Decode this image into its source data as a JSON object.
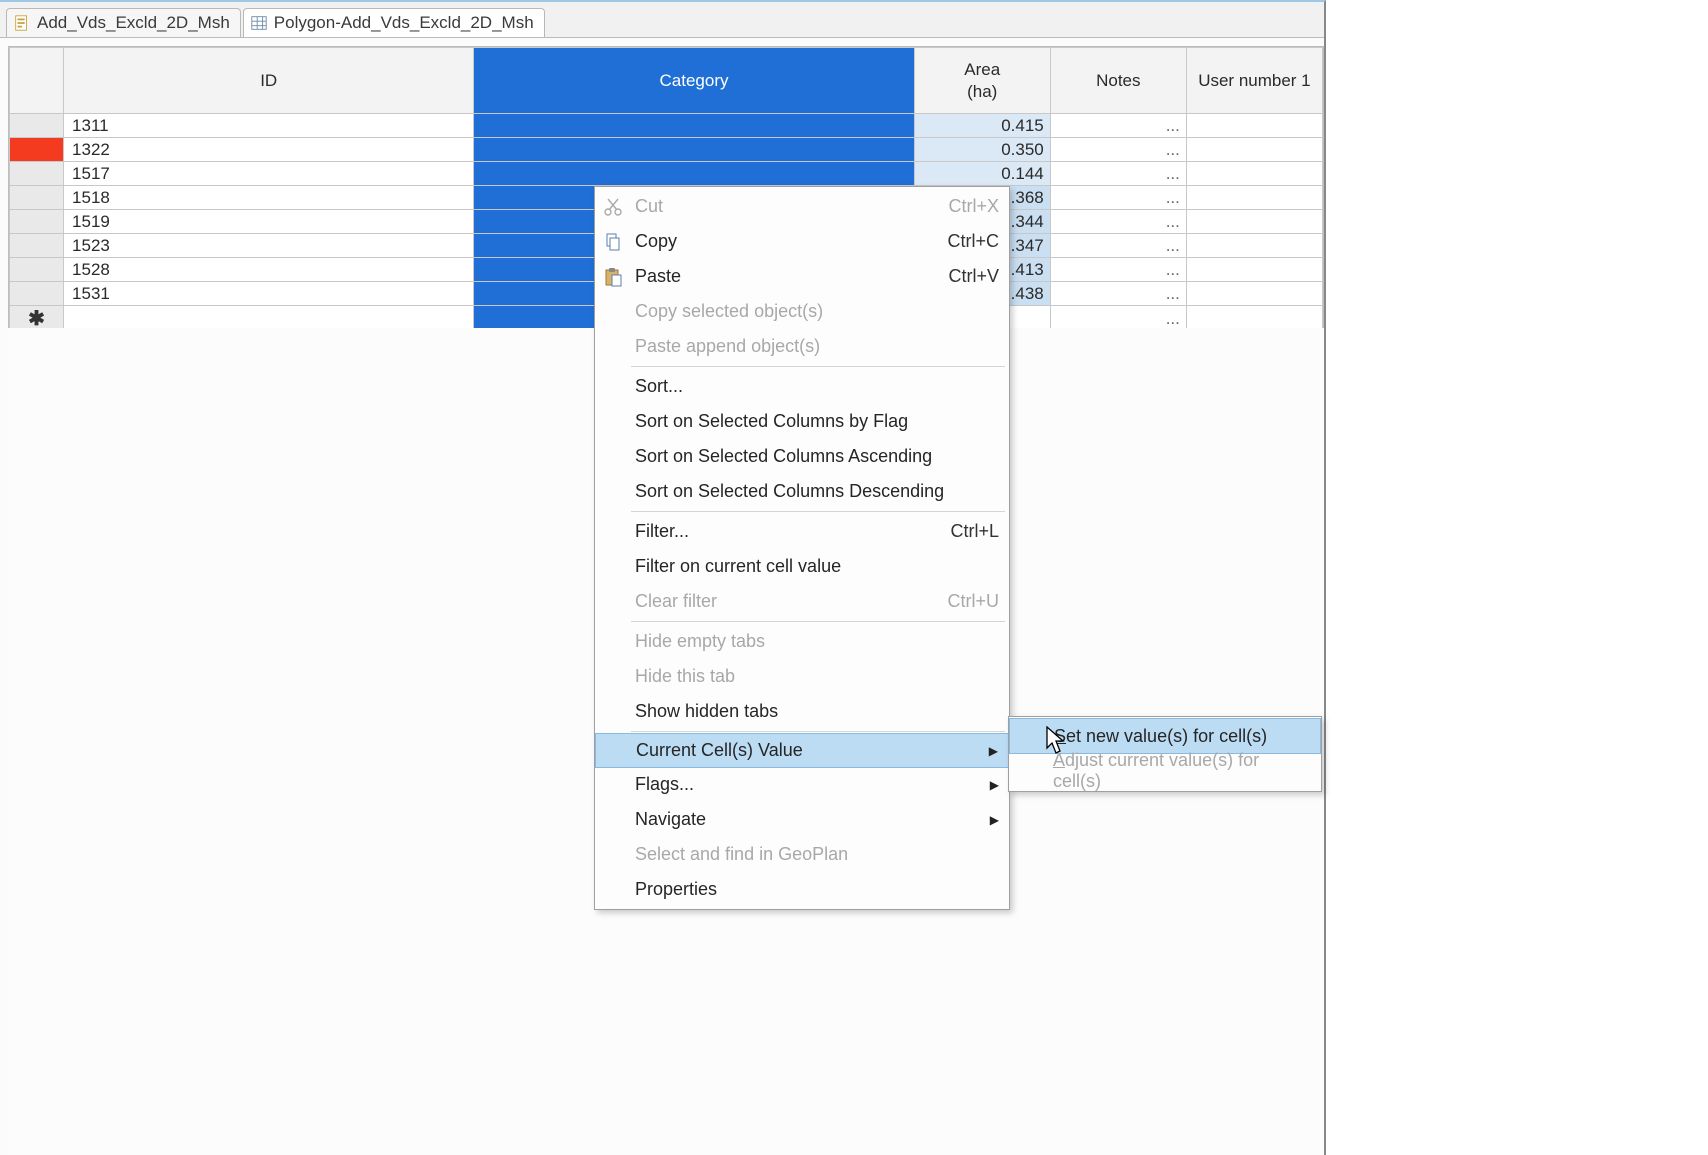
{
  "tabs": [
    {
      "label": "Add_Vds_Excld_2D_Msh",
      "icon": "doc"
    },
    {
      "label": "Polygon-Add_Vds_Excld_2D_Msh",
      "icon": "table"
    }
  ],
  "columns": {
    "id": "ID",
    "category": "Category",
    "area": "Area\n(ha)",
    "notes": "Notes",
    "usernum1": "User number 1"
  },
  "rows": [
    {
      "id": "1311",
      "area": "0.415",
      "notes": "...",
      "flag": false
    },
    {
      "id": "1322",
      "area": "0.350",
      "notes": "...",
      "flag": true
    },
    {
      "id": "1517",
      "area": "0.144",
      "notes": "...",
      "flag": false
    },
    {
      "id": "1518",
      "area": ".368",
      "notes": "...",
      "flag": false
    },
    {
      "id": "1519",
      "area": ".344",
      "notes": "...",
      "flag": false
    },
    {
      "id": "1523",
      "area": ".347",
      "notes": "...",
      "flag": false
    },
    {
      "id": "1528",
      "area": ".413",
      "notes": "...",
      "flag": false
    },
    {
      "id": "1531",
      "area": ".438",
      "notes": "...",
      "flag": false
    }
  ],
  "newrow_notes": "...",
  "menu": {
    "cut": "Cut",
    "cut_sc": "Ctrl+X",
    "copy": "Copy",
    "copy_sc": "Ctrl+C",
    "paste": "Paste",
    "paste_sc": "Ctrl+V",
    "copysel": "Copy selected object(s)",
    "pasteapp": "Paste append object(s)",
    "sort": "Sort...",
    "sortflag": "Sort on Selected Columns by Flag",
    "sortasc": "Sort on Selected Columns Ascending",
    "sortdesc": "Sort on Selected Columns Descending",
    "filter": "Filter...",
    "filter_sc": "Ctrl+L",
    "filtercur": "Filter on current cell value",
    "clearfilter": "Clear filter",
    "clearfilter_sc": "Ctrl+U",
    "hideempty": "Hide empty tabs",
    "hidethis": "Hide this tab",
    "showhidden": "Show hidden tabs",
    "curcell": "Current Cell(s) Value",
    "flags": "Flags...",
    "navigate": "Navigate",
    "selgeo": "Select and find in GeoPlan",
    "props": "Properties"
  },
  "submenu": {
    "setnew_pre": "S",
    "setnew_rest": "et new value(s) for cell(s)",
    "adjust_pre": "A",
    "adjust_rest": "djust current value(s) for cell(s)"
  }
}
